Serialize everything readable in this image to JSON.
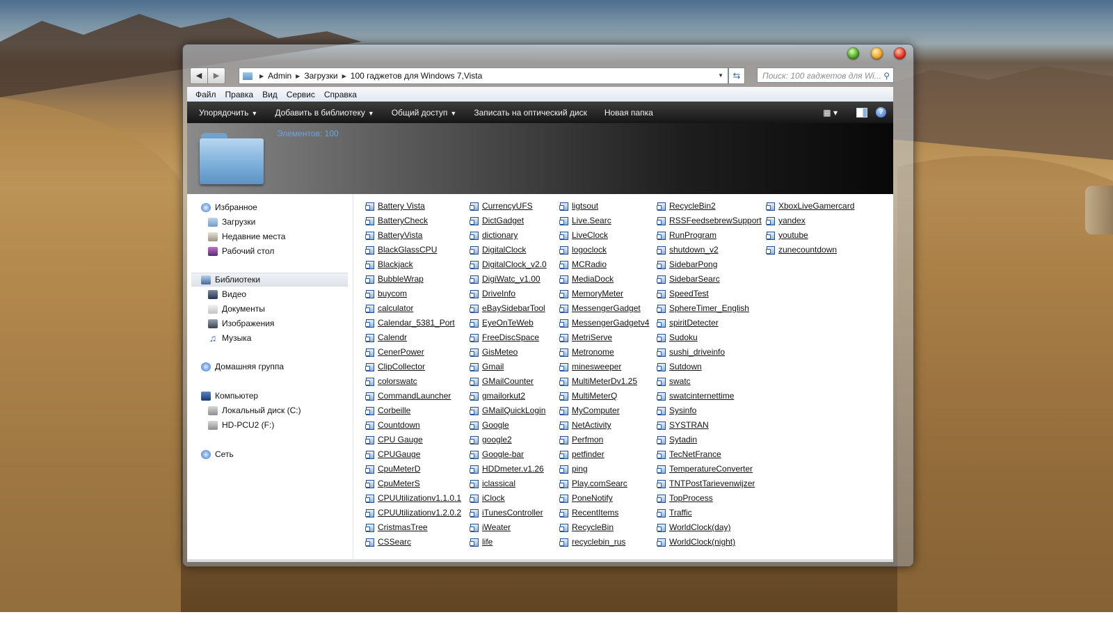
{
  "window": {
    "buttons": {
      "maximize_icon": "green-orb",
      "minimize_icon": "orange-orb",
      "close_icon": "red-orb"
    }
  },
  "navigation": {
    "back_icon": "◀",
    "forward_icon": "▶",
    "breadcrumb": [
      "Admin",
      "Загрузки",
      "100 гаджетов для Windows 7,Vista"
    ],
    "search_placeholder": "Поиск: 100 гаджетов для Wi..."
  },
  "menubar": [
    "Файл",
    "Правка",
    "Вид",
    "Сервис",
    "Справка"
  ],
  "commands": {
    "organize": "Упорядочить",
    "add_to_library": "Добавить в библиотеку",
    "share": "Общий доступ",
    "burn": "Записать на оптический диск",
    "new_folder": "Новая папка"
  },
  "details": {
    "items_count": "Элементов: 100"
  },
  "sidebar": {
    "favorites": "Избранное",
    "downloads": "Загрузки",
    "recent": "Недавние места",
    "desktop": "Рабочий стол",
    "libraries": "Библиотеки",
    "video": "Видео",
    "documents": "Документы",
    "images": "Изображения",
    "music": "Музыка",
    "homegroup": "Домашняя группа",
    "computer": "Компьютер",
    "disk_c": "Локальный диск (C:)",
    "disk_f": "HD-PCU2 (F:)",
    "network": "Сеть"
  },
  "files": [
    [
      "Battery Vista",
      "BatteryCheck",
      "BatteryVista",
      "BlackGlassCPU",
      "Blackjack",
      "BubbleWrap",
      "buycom",
      "calculator",
      "Calendar_5381_Port",
      "Calendr",
      "CenerPower",
      "ClipCollector",
      "colorswatc",
      "CommandLauncher",
      "Corbeille",
      "Countdown",
      "CPU Gauge",
      "CPUGauge",
      "CpuMeterD",
      "CpuMeterS",
      "CPUUtilizationv1.1.0.1",
      "CPUUtilizationv1.2.0.2",
      "CristmasTree",
      "CSSearc"
    ],
    [
      "CurrencyUFS",
      "DictGadget",
      "dictionary",
      "DigitalClock",
      "DigitalClock_v2.0",
      "DigiWatc_v1.00",
      "DriveInfo",
      "eBaySidebarTool",
      "EyeOnTeWeb",
      "FreeDiscSpace",
      "GisMeteo",
      "Gmail",
      "GMailCounter",
      "gmailorkut2",
      "GMailQuickLogin",
      "Google",
      "google2",
      "Google-bar",
      "HDDmeter.v1.26",
      "iclassical",
      "iClock",
      "iTunesController",
      "iWeater",
      "life"
    ],
    [
      "ligtsout",
      "Live.Searc",
      "LiveClock",
      "logoclock",
      "MCRadio",
      "MediaDock",
      "MemoryMeter",
      "MessengerGadget",
      "MessengerGadgetv4",
      "MetriServe",
      "Metronome",
      "minesweeper",
      "MultiMeterDv1.25",
      "MultiMeterQ",
      "MyComputer",
      "NetActivity",
      "Perfmon",
      "petfinder",
      "ping",
      "Play.comSearc",
      "PoneNotify",
      "RecentItems",
      "RecycleBin",
      "recyclebin_rus"
    ],
    [
      "RecycleBin2",
      "RSSFeedsebrewSupport",
      "RunProgram",
      "shutdown_v2",
      "SidebarPong",
      "SidebarSearc",
      "SpeedTest",
      "SphereTimer_English",
      "spiritDetecter",
      "Sudoku",
      "sushi_driveinfo",
      "Sutdown",
      "swatc",
      "swatcinternettime",
      "Sysinfo",
      "SYSTRAN",
      "Sytadin",
      "TecNetFrance",
      "TemperatureConverter",
      "TNTPostTarievenwijzer",
      "TopProcess",
      "Traffic",
      "WorldClock(day)",
      "WorldClock(night)"
    ],
    [
      "XboxLiveGamercard",
      "yandex",
      "youtube",
      "zunecountdown"
    ]
  ]
}
